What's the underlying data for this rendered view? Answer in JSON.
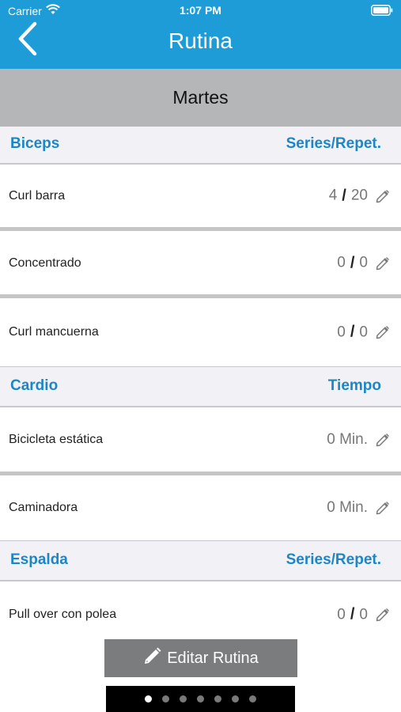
{
  "status_bar": {
    "carrier": "Carrier",
    "time": "1:07 PM"
  },
  "nav": {
    "title": "Rutina"
  },
  "day": "Martes",
  "sections": [
    {
      "name": "Biceps",
      "column": "Series/Repet.",
      "rows": [
        {
          "label": "Curl barra",
          "series": "4",
          "reps": "20"
        },
        {
          "label": "Concentrado",
          "series": "0",
          "reps": "0"
        },
        {
          "label": "Curl mancuerna",
          "series": "0",
          "reps": "0"
        }
      ]
    },
    {
      "name": "Cardio",
      "column": "Tiempo",
      "rows": [
        {
          "label": "Bicicleta estática",
          "value": "0 Min."
        },
        {
          "label": "Caminadora",
          "value": "0 Min."
        }
      ]
    },
    {
      "name": "Espalda",
      "column": "Series/Repet.",
      "rows": [
        {
          "label": "Pull over con polea",
          "series": "0",
          "reps": "0"
        }
      ]
    }
  ],
  "edit_button": {
    "label": "Editar Rutina"
  },
  "pager": {
    "pages": 7,
    "current": 1
  },
  "icons": {
    "back": "chevron-left-icon",
    "edit": "pencil-icon",
    "wifi": "wifi-icon",
    "battery": "battery-icon"
  },
  "colors": {
    "nav": "#1E9CD7",
    "section_text": "#1B87C6",
    "day_band": "#B4B6B7",
    "button": "#7B7C7E"
  }
}
